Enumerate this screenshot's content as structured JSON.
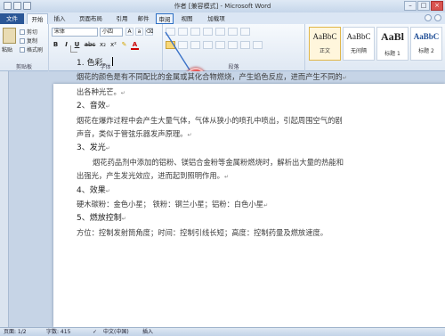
{
  "window": {
    "title": "作者 [兼容模式] - Microsoft Word"
  },
  "tabs": {
    "file": "文件",
    "home": "开始",
    "insert": "插入",
    "layout": "页面布局",
    "references": "引用",
    "mailings": "邮件",
    "review": "审阅",
    "view": "视图",
    "addins": "加载项"
  },
  "ribbon": {
    "clipboard": {
      "paste": "粘贴",
      "cut": "剪切",
      "copy": "复制",
      "format_painter": "格式刷",
      "label": "剪贴板"
    },
    "font": {
      "name": "宋体",
      "size": "小四",
      "label": "字体",
      "buttons": [
        "B",
        "I",
        "U",
        "abc",
        "x₂",
        "x²"
      ]
    },
    "paragraph": {
      "label": "段落"
    },
    "styles": {
      "items": [
        {
          "preview": "AaBbC",
          "name": "正文"
        },
        {
          "preview": "AaBbC",
          "name": "无间隔"
        },
        {
          "preview": "AaBl",
          "name": "标题 1"
        },
        {
          "preview": "AaBbC",
          "name": "标题 2"
        }
      ]
    }
  },
  "callout": {
    "number": "2"
  },
  "document": {
    "lines": [
      "1. 色彩。",
      "烟花的颜色是有不同配比的金属或其化合物燃烧，产生焰色反应，进而产生不同的",
      "出各种光芒。",
      "2、音效",
      "烟花在爆炸过程中会产生大量气体，气体从狭小的喷孔中喷出，引起周围空气的剧",
      "声音，类似于管弦乐器发声原理。",
      "3、发光",
      "烟花药品剂中添加的铝粉、镁铝合金粉等金属粉燃烧时，解析出大量的热能和",
      "出强光，产生发光效应，进而起到照明作用。",
      "4、效果",
      "硬木碳粉：金色小星；  铁粉：钢兰小星；铝粉：白色小星",
      "5、燃放控制",
      "方位：控制发射筒角度；时间：控制引线长短；高度：控制药量及燃放速度。"
    ]
  },
  "statusbar": {
    "page": "页面: 1/2",
    "words": "字数: 415",
    "language": "中文(中国)",
    "mode": "插入"
  }
}
